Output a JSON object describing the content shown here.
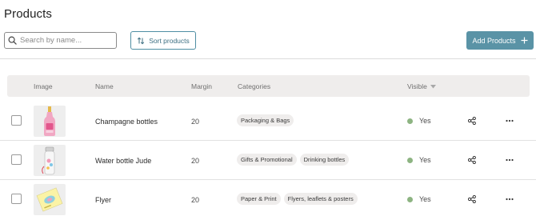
{
  "page": {
    "title": "Products"
  },
  "toolbar": {
    "search_placeholder": "Search by name...",
    "search_value": "",
    "sort_label": "Sort products",
    "add_label": "Add Products"
  },
  "colors": {
    "accent": "#5a93a6",
    "visible_dot": "#8db482",
    "chip_bg": "#efedec"
  },
  "table": {
    "headers": {
      "image": "Image",
      "name": "Name",
      "margin": "Margin",
      "categories": "Categories",
      "visible": "Visible"
    },
    "rows": [
      {
        "name": "Champagne bottles",
        "margin": "20",
        "categories": [
          "Packaging & Bags"
        ],
        "visible": "Yes",
        "image": "champagne-bottle-image"
      },
      {
        "name": "Water bottle Jude",
        "margin": "20",
        "categories": [
          "Gifts & Promotional",
          "Drinking bottles"
        ],
        "visible": "Yes",
        "image": "water-bottle-image"
      },
      {
        "name": "Flyer",
        "margin": "20",
        "categories": [
          "Paper & Print",
          "Flyers, leaflets & posters"
        ],
        "visible": "Yes",
        "image": "flyer-image"
      }
    ]
  },
  "icons": {
    "search": "search-icon",
    "sort": "sort-icon",
    "add": "plus-icon",
    "share": "share-icon",
    "more": "more-icon",
    "filter": "caret-down-icon"
  }
}
